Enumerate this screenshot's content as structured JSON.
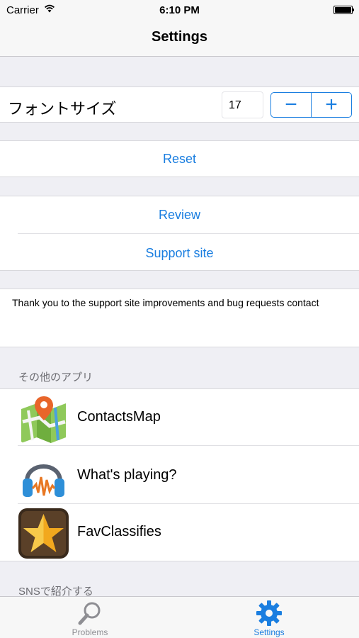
{
  "status_bar": {
    "carrier": "Carrier",
    "time": "6:10 PM"
  },
  "nav_bar": {
    "title": "Settings"
  },
  "font_size": {
    "label": "フォントサイズ",
    "value": "17",
    "minus": "−",
    "plus": "+"
  },
  "actions": {
    "reset": "Reset",
    "review": "Review",
    "support_site": "Support site"
  },
  "message": "Thank you to the support site improvements and bug requests contact",
  "other_apps": {
    "header": "その他のアプリ",
    "items": [
      {
        "name": "ContactsMap",
        "icon": "map-pin-icon"
      },
      {
        "name": "What's playing?",
        "icon": "headphones-icon"
      },
      {
        "name": "FavClassifies",
        "icon": "star-icon"
      }
    ]
  },
  "sns": {
    "header": "SNSで紹介する"
  },
  "tabs": [
    {
      "label": "Problems",
      "icon": "search-icon",
      "active": false
    },
    {
      "label": "Settings",
      "icon": "gear-icon",
      "active": true
    }
  ],
  "colors": {
    "accent": "#1a7ee0",
    "background": "#efeff4",
    "inactive_tab": "#8e8e93"
  }
}
